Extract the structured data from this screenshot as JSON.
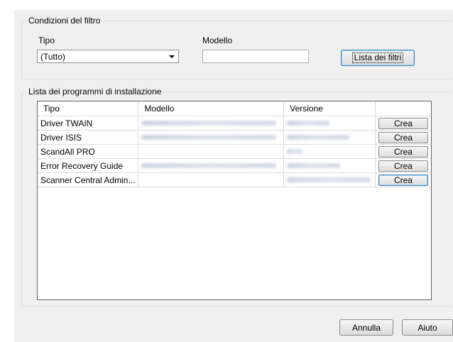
{
  "filter": {
    "legend": "Condizioni del filtro",
    "type_label": "Tipo",
    "type_value": "(Tutto)",
    "model_label": "Modello",
    "model_value": "",
    "list_button": "Lista dei filtri"
  },
  "installers": {
    "legend": "Lista dei programmi di installazione",
    "columns": [
      "Tipo",
      "Modello",
      "Versione",
      ""
    ],
    "rows": [
      {
        "type": "Driver TWAIN",
        "model_visible": true,
        "version_visible": true,
        "action": "Crea"
      },
      {
        "type": "Driver ISIS",
        "model_visible": true,
        "version_visible": true,
        "action": "Crea"
      },
      {
        "type": "ScandAll PRO",
        "model_visible": false,
        "version_visible": true,
        "action": "Crea"
      },
      {
        "type": "Error Recovery Guide",
        "model_visible": true,
        "version_visible": true,
        "action": "Crea"
      },
      {
        "type": "Scanner Central Admin...",
        "model_visible": false,
        "version_visible": true,
        "action": "Crea"
      }
    ]
  },
  "footer": {
    "cancel": "Annulla",
    "help": "Aiuto"
  },
  "colors": {
    "panel_bg": "#f0f0f0",
    "focus_border": "#3c7fb1"
  }
}
